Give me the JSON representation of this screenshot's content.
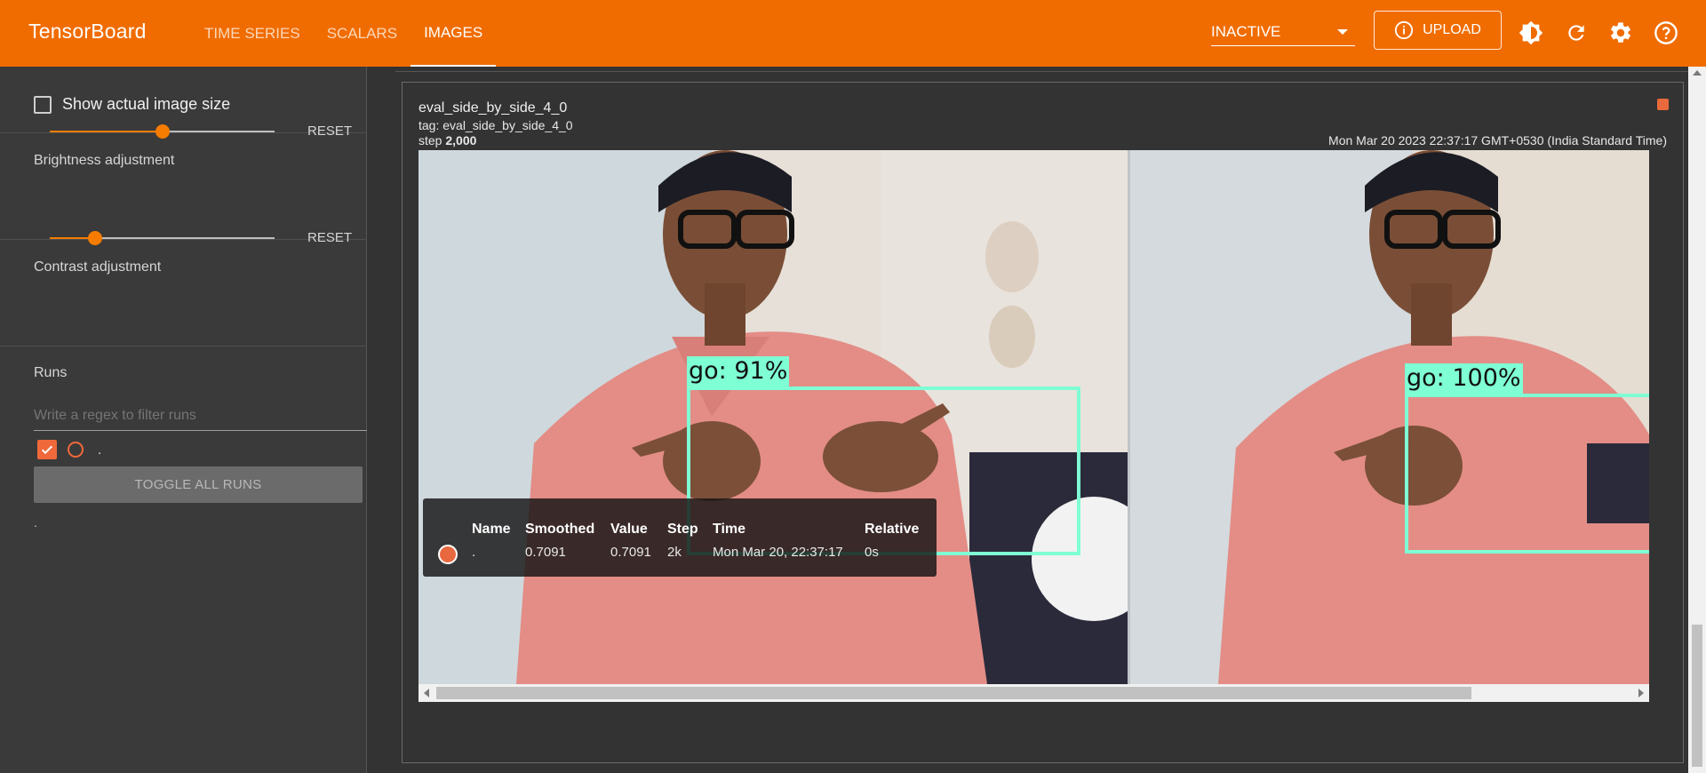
{
  "app": {
    "brand": "TensorBoard",
    "tabs": [
      {
        "label": "TIME SERIES",
        "active": false
      },
      {
        "label": "SCALARS",
        "active": false
      },
      {
        "label": "IMAGES",
        "active": true
      }
    ],
    "run_status": "INACTIVE",
    "upload_label": "UPLOAD",
    "accent_color": "#f06c00"
  },
  "sidebar": {
    "show_actual_size_label": "Show actual image size",
    "show_actual_size_checked": false,
    "brightness": {
      "label": "Brightness adjustment",
      "value": 0.5,
      "reset_label": "RESET"
    },
    "contrast": {
      "label": "Contrast adjustment",
      "value": 0.2,
      "reset_label": "RESET"
    },
    "runs": {
      "title": "Runs",
      "filter_placeholder": "Write a regex to filter runs",
      "items": [
        {
          "name": ".",
          "checked": true,
          "color": "#f0693a"
        }
      ],
      "toggle_all_label": "TOGGLE ALL RUNS",
      "footer_text": "."
    }
  },
  "card": {
    "title": "eval_side_by_side_4_0",
    "tag": "tag: eval_side_by_side_4_0",
    "step_prefix": "step",
    "step_value": "2,000",
    "timestamp": "Mon Mar 20 2023 22:37:17 GMT+0530 (India Standard Time)",
    "pin_color": "#e86a3c",
    "detections": [
      {
        "label": "go: 91%"
      },
      {
        "label": "go: 100%"
      }
    ]
  },
  "tooltip": {
    "headers": {
      "name": "Name",
      "smoothed": "Smoothed",
      "value": "Value",
      "step": "Step",
      "time": "Time",
      "relative": "Relative"
    },
    "row": {
      "name": ".",
      "smoothed": "0.7091",
      "value": "0.7091",
      "step": "2k",
      "time": "Mon Mar 20, 22:37:17",
      "relative": "0s",
      "color": "#e8683f"
    }
  }
}
